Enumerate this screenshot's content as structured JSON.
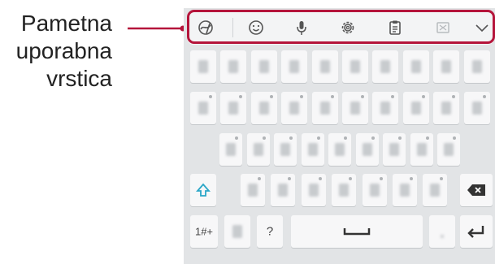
{
  "callout": {
    "lines": [
      "Pametna",
      "uporabna",
      "vrstica"
    ],
    "line_color": "#b5153b"
  },
  "toolbar": {
    "icons": [
      "handwriting-icon",
      "emoji-icon",
      "microphone-icon",
      "settings-icon",
      "clipboard-icon",
      "resize-icon",
      "collapse-icon"
    ]
  },
  "keyboard": {
    "row1_keys": 10,
    "row2_keys": 10,
    "row3_keys": 9,
    "symbols_key": "1#+",
    "question_key": "?",
    "icons": [
      "shift-icon",
      "backspace-icon",
      "spacebar-icon",
      "enter-icon"
    ],
    "accent": "#2aa6c7"
  }
}
